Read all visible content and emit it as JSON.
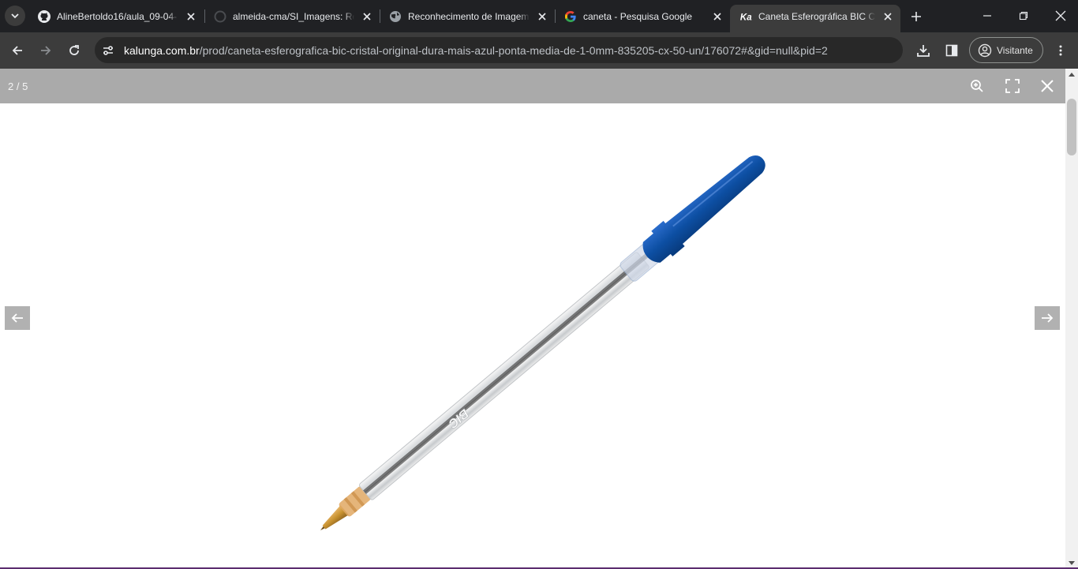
{
  "browser": {
    "tabs": [
      {
        "title": "AlineBertoldo16/aula_09-04-",
        "icon": "github-icon",
        "active": false
      },
      {
        "title": "almeida-cma/SI_Imagens: Re",
        "icon": "github-loading-icon",
        "active": false
      },
      {
        "title": "Reconhecimento de Imagem",
        "icon": "globe-icon",
        "active": false
      },
      {
        "title": "caneta - Pesquisa Google",
        "icon": "google-icon",
        "active": false
      },
      {
        "title": "Caneta Esferográfica BIC Crist",
        "icon": "kalunga-icon",
        "active": true
      }
    ],
    "url": {
      "host": "kalunga.com.br",
      "path": "/prod/caneta-esferografica-bic-cristal-original-dura-mais-azul-ponta-media-de-1-0mm-835205-cx-50-un/176072#&gid=null&pid=2"
    },
    "profile_label": "Visitante",
    "favicon_text": "Ka"
  },
  "viewer": {
    "counter": "2 / 5",
    "pen_brand": "BIC",
    "colors": {
      "bar": "#aaaaaa",
      "pen_cap": "#0d4fa3",
      "pen_tip": "#c8922f"
    }
  }
}
